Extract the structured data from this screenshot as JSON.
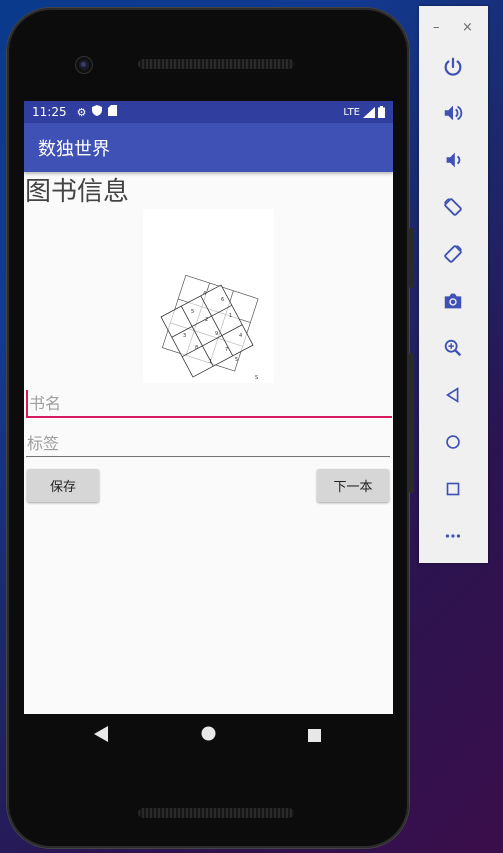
{
  "status_bar": {
    "time": "11:25",
    "network": "LTE"
  },
  "app_bar": {
    "title": "数独世界"
  },
  "page": {
    "title": "图书信息"
  },
  "form": {
    "book_name_placeholder": "书名",
    "tags_placeholder": "标签",
    "save_label": "保存",
    "next_label": "下一本"
  },
  "cover_image": {
    "alt": "sudoku book cover"
  },
  "emulator_panel": {
    "window_controls": {
      "minimize": "–",
      "close": "×"
    },
    "icons": [
      "power-icon",
      "volume-up-icon",
      "volume-down-icon",
      "rotate-left-icon",
      "rotate-right-icon",
      "camera-icon",
      "zoom-icon",
      "back-icon",
      "home-icon",
      "overview-icon",
      "more-icon"
    ]
  },
  "colors": {
    "status_bar": "#303f9f",
    "app_bar": "#3f51b5",
    "accent": "#d81b60"
  }
}
